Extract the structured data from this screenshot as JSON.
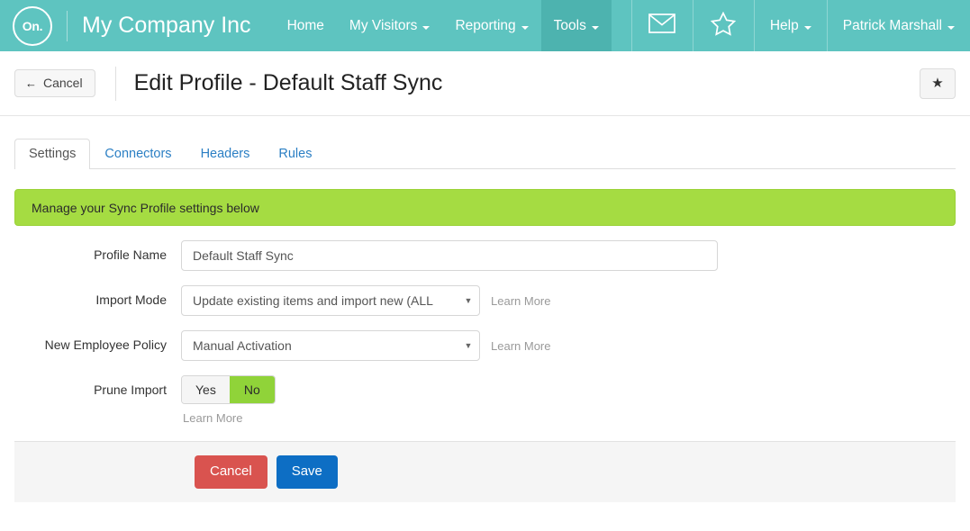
{
  "navbar": {
    "logo_text": "On.",
    "brand": "My Company Inc",
    "items": [
      {
        "label": "Home",
        "has_caret": false,
        "active": false
      },
      {
        "label": "My Visitors",
        "has_caret": true,
        "active": false
      },
      {
        "label": "Reporting",
        "has_caret": true,
        "active": false
      },
      {
        "label": "Tools",
        "has_caret": true,
        "active": true
      }
    ],
    "right": {
      "mail_icon": "envelope-icon",
      "favorites_icon": "star-outline-icon",
      "help_label": "Help",
      "user_label": "Patrick Marshall"
    }
  },
  "header": {
    "cancel_label": "Cancel",
    "back_arrow": "←",
    "title": "Edit Profile - Default Staff Sync",
    "star_glyph": "★"
  },
  "tabs": [
    {
      "label": "Settings",
      "active": true
    },
    {
      "label": "Connectors",
      "active": false
    },
    {
      "label": "Headers",
      "active": false
    },
    {
      "label": "Rules",
      "active": false
    }
  ],
  "alert": {
    "message": "Manage your Sync Profile settings below"
  },
  "form": {
    "profile_name": {
      "label": "Profile Name",
      "value": "Default Staff Sync",
      "placeholder": "Profile Name"
    },
    "import_mode": {
      "label": "Import Mode",
      "value": "Update existing items and import new (ALL",
      "arrow": "▼",
      "learn_more": "Learn More"
    },
    "new_employee_policy": {
      "label": "New Employee Policy",
      "value": "Manual Activation",
      "arrow": "▼",
      "learn_more": "Learn More"
    },
    "prune_import": {
      "label": "Prune Import",
      "yes_label": "Yes",
      "no_label": "No",
      "selected": "No",
      "learn_more": "Learn More"
    }
  },
  "footer": {
    "cancel_label": "Cancel",
    "save_label": "Save"
  },
  "colors": {
    "nav_bg": "#5ec4c0",
    "nav_active": "#4db3af",
    "alert_green": "#a5dc42",
    "toggle_green": "#90d339",
    "link_blue": "#2b7fc4",
    "save_blue": "#0d6ec4",
    "cancel_red": "#d9534f"
  }
}
